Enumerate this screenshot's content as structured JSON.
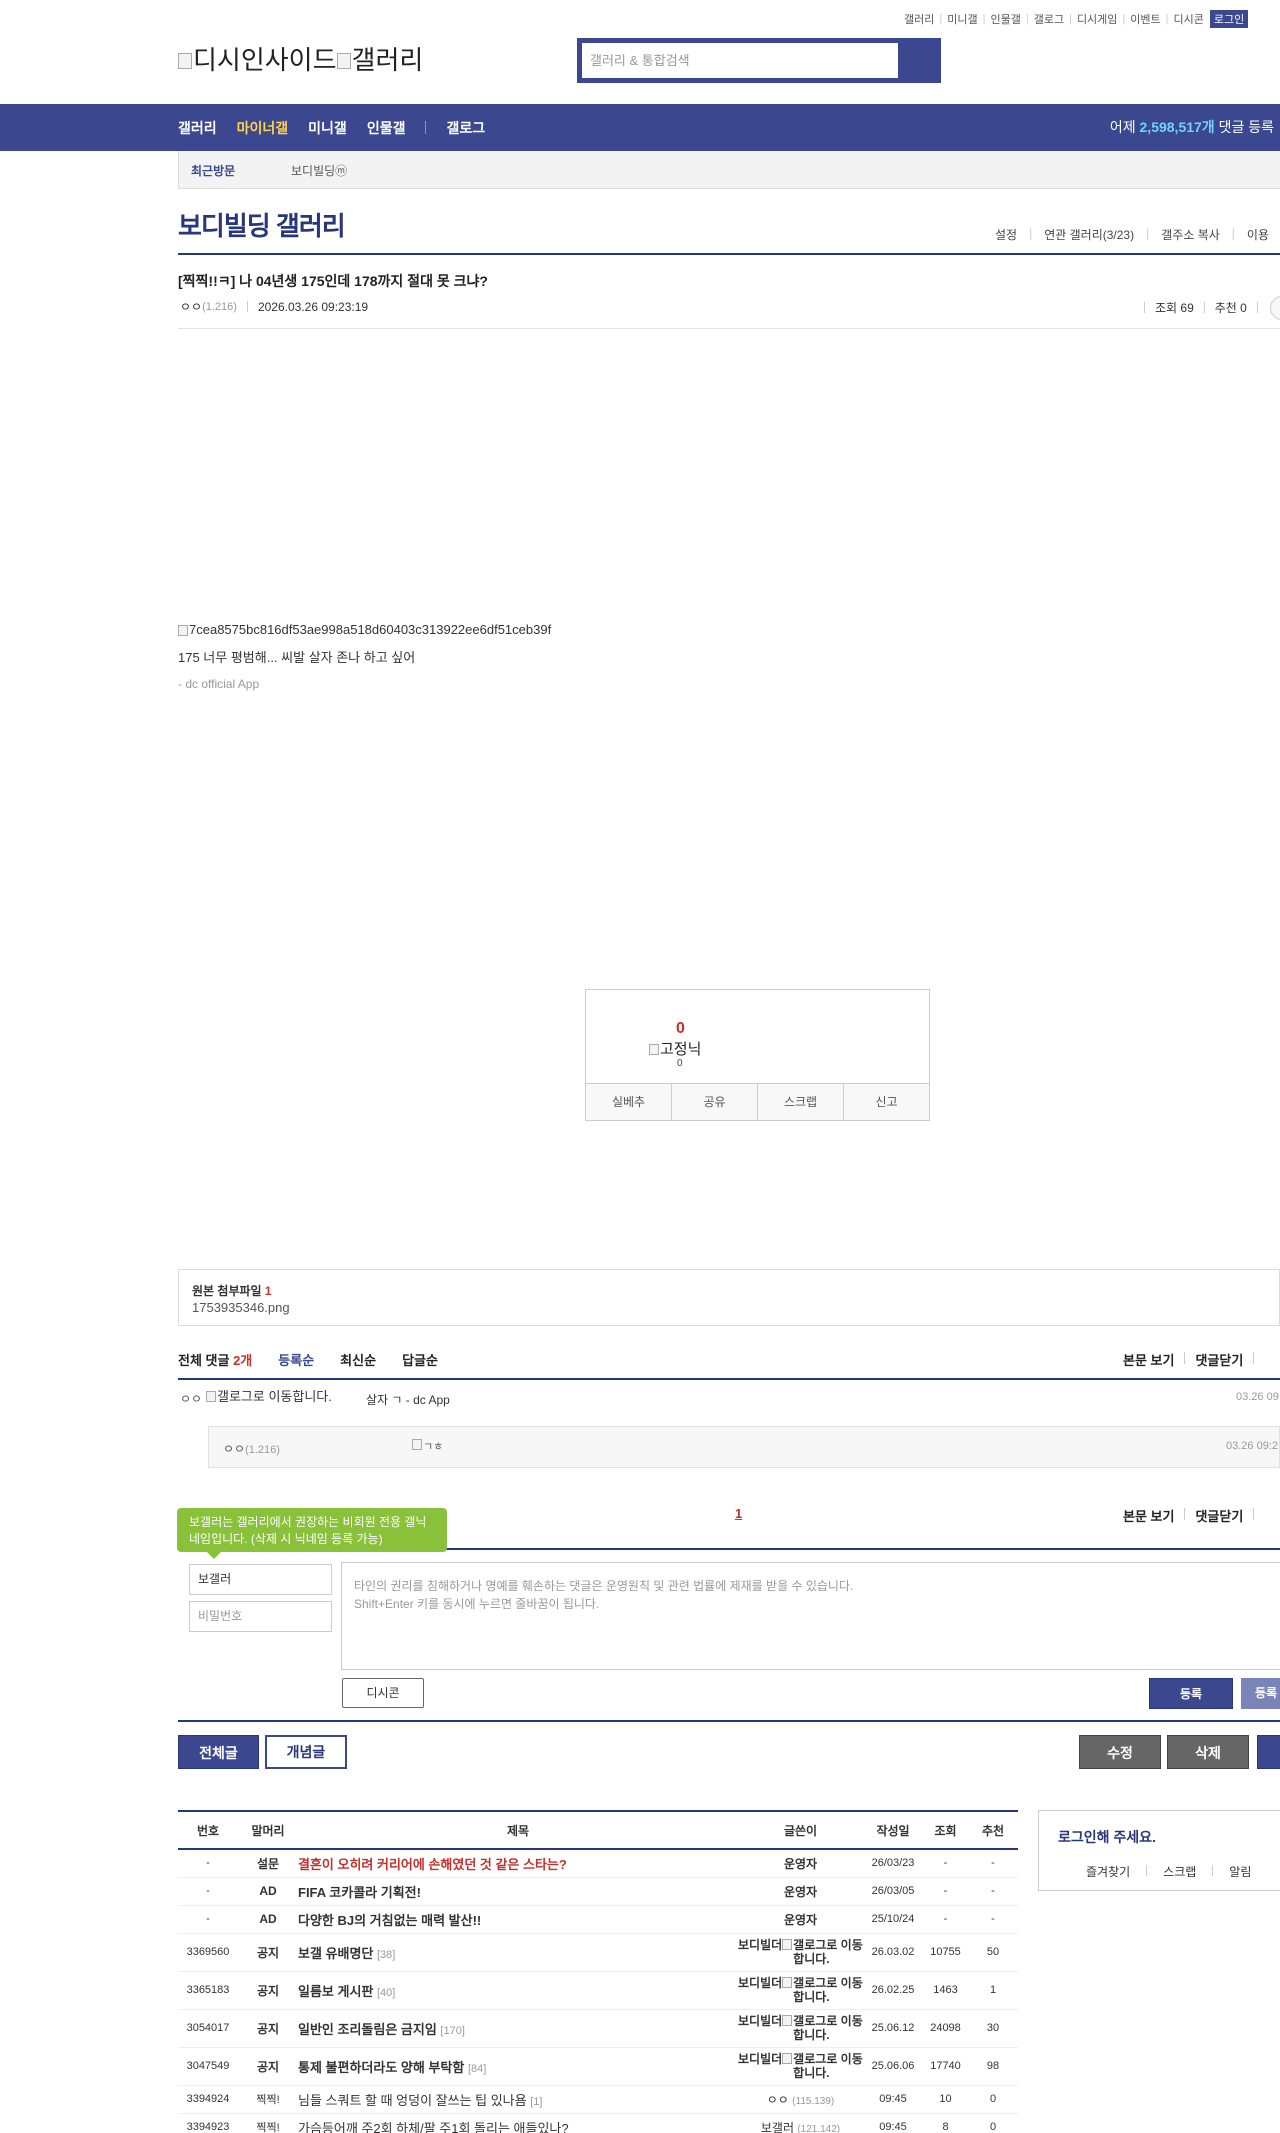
{
  "util_menu": [
    "갤러리",
    "미니갤",
    "인물갤",
    "갤로그",
    "디시게임",
    "이벤트",
    "디시콘"
  ],
  "login_label": "로그인",
  "logo": {
    "site": "디시인사이드",
    "section": "갤러리"
  },
  "search": {
    "placeholder": "갤러리 & 통합검색"
  },
  "gnb": {
    "items": [
      "갤러리",
      "마이너갤",
      "미니갤",
      "인물갤",
      "갤로그"
    ],
    "stat_prefix": "어제 ",
    "stat_value": "2,598,517개",
    "stat_suffix": " 댓글 등록"
  },
  "recent": {
    "label": "최근방문",
    "item": "보디빌딩ⓜ"
  },
  "gallery": {
    "title": "보디빌딩 갤러리",
    "menu": [
      "설정",
      "연관 갤러리(3/23)",
      "갤주소 복사",
      "이용"
    ]
  },
  "post": {
    "title": "[찍찍!!ㅋ] 나 04년생 175인데 178까지 절대 못 크냐?",
    "writer": "ㅇㅇ",
    "writer_ip": "(1.216)",
    "date": "2026.03.26 09:23:19",
    "views": "조회 69",
    "recommend": "추천 0",
    "image_alt": "7cea8575bc816df53ae998a518d60403c313922ee6df51ceb39f",
    "body": "175 너무 평범해... 씨발 살자 존나 하고 싶어",
    "signature": "- dc official App"
  },
  "recommend_box": {
    "count": "0",
    "fixed_nick_alt": "고정닉",
    "fixed_count": "0",
    "buttons": [
      "실베추",
      "공유",
      "스크랩",
      "신고"
    ]
  },
  "attachment": {
    "label": "원본 첨부파일",
    "count": "1",
    "file": "1753935346.png"
  },
  "comments": {
    "total_label": "전체 댓글",
    "total_count": "2개",
    "sorts": [
      "등록순",
      "최신순",
      "답글순"
    ],
    "right": [
      "본문 보기",
      "댓글닫기"
    ],
    "first": {
      "writer": "ㅇㅇ",
      "img_alt": "갤로그로 이동합니다.",
      "text": "살자 ㄱ - dc App",
      "date": "03.26 09"
    },
    "reply": {
      "writer": "ㅇㅇ",
      "ip": "(1.216)",
      "img_alt": "ㄱㅎ",
      "date": "03.26 09:2"
    },
    "page": "1"
  },
  "write": {
    "tip": "보갤러는 갤러리에서 권장하는 비회원 전용 갤닉네임입니다. (삭제 시 닉네임 등록 가능)",
    "nick": "보갤러",
    "password": "비밀번호",
    "placeholder_1": "타인의 권리를 침해하거나 명예를 훼손하는 댓글은 운영원칙 및 관련 법률에 제재를 받을 수 있습니다.",
    "placeholder_2": "Shift+Enter 키를 동시에 누르면 줄바꿈이 됩니다.",
    "dccon": "디시콘",
    "submit": "등록",
    "submit2": "등록"
  },
  "actions": {
    "all": "전체글",
    "concept": "개념글",
    "edit": "수정",
    "delete": "삭제"
  },
  "list": {
    "headers": [
      "번호",
      "말머리",
      "제목",
      "글쓴이",
      "작성일",
      "조회",
      "추천"
    ],
    "rows": [
      {
        "no": "-",
        "head": "설문",
        "title": "결혼이 오히려 커리어에 손해였던 것 같은 스타는?",
        "cmt": "",
        "writer": "운영자",
        "ip": "",
        "date": "26/03/23",
        "views": "-",
        "rec": "-"
      },
      {
        "no": "-",
        "head": "AD",
        "title": "FIFA 코카콜라 기획전!",
        "cmt": "",
        "writer": "운영자",
        "ip": "",
        "date": "26/03/05",
        "views": "-",
        "rec": "-"
      },
      {
        "no": "-",
        "head": "AD",
        "title": "다양한 BJ의 거침없는 매력 발산!!",
        "cmt": "",
        "writer": "운영자",
        "ip": "",
        "date": "25/10/24",
        "views": "-",
        "rec": "-"
      },
      {
        "no": "3369560",
        "head": "공지",
        "title": "보갤 유배명단",
        "cmt": "[38]",
        "writer": "보디빌더",
        "ip": "",
        "date": "26.03.02",
        "views": "10755",
        "rec": "50"
      },
      {
        "no": "3365183",
        "head": "공지",
        "title": "일름보 게시판",
        "cmt": "[40]",
        "writer": "보디빌더",
        "ip": "",
        "date": "26.02.25",
        "views": "1463",
        "rec": "1"
      },
      {
        "no": "3054017",
        "head": "공지",
        "title": "일반인 조리돌림은 금지임",
        "cmt": "[170]",
        "writer": "보디빌더",
        "ip": "",
        "date": "25.06.12",
        "views": "24098",
        "rec": "30"
      },
      {
        "no": "3047549",
        "head": "공지",
        "title": "통제 불편하더라도 양해 부탁함",
        "cmt": "[84]",
        "writer": "보디빌더",
        "ip": "",
        "date": "25.06.06",
        "views": "17740",
        "rec": "98"
      },
      {
        "no": "3394924",
        "head": "찍찍!",
        "title": "님들 스쿼트 할 때 엉덩이 잘쓰는 팁 있나욤",
        "cmt": "[1]",
        "writer": "ㅇㅇ",
        "ip": "(115.139)",
        "date": "09:45",
        "views": "10",
        "rec": "0"
      },
      {
        "no": "3394923",
        "head": "찍찍!",
        "title": "가슴등어깨 주2회 하체/팔 주1회 돌리는 애들있나?",
        "cmt": "",
        "writer": "보갤러",
        "ip": "(121.142)",
        "date": "09:45",
        "views": "8",
        "rec": "0"
      }
    ],
    "writer_img_alt": "갤로그로 이동합니다."
  },
  "login_box": {
    "title": "로그인해 주세요.",
    "menu": [
      "즐겨찾기",
      "스크랩",
      "알림"
    ]
  },
  "colors": {
    "brand": "#3b4890",
    "accent": "#c4302b",
    "highlight": "#ffd34d",
    "tip": "#8ac13b"
  }
}
